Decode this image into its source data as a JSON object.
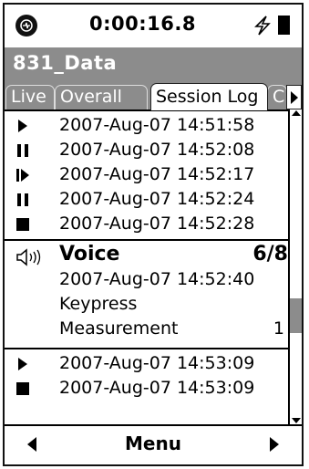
{
  "status": {
    "timer": "0:00:16.8"
  },
  "title": "831_Data",
  "tabs": [
    {
      "label": "Live",
      "active": false
    },
    {
      "label": "Overall",
      "active": false
    },
    {
      "label": "Session Log",
      "active": true
    },
    {
      "label": "C",
      "active": false
    }
  ],
  "log": {
    "top_entries": [
      {
        "icon": "play-icon",
        "timestamp": "2007-Aug-07 14:51:58"
      },
      {
        "icon": "pause-icon",
        "timestamp": "2007-Aug-07 14:52:08"
      },
      {
        "icon": "resume-icon",
        "timestamp": "2007-Aug-07 14:52:17"
      },
      {
        "icon": "pause-icon",
        "timestamp": "2007-Aug-07 14:52:24"
      },
      {
        "icon": "stop-icon",
        "timestamp": "2007-Aug-07 14:52:28"
      }
    ],
    "voice": {
      "icon": "speaker-icon",
      "label": "Voice",
      "count": "6/8",
      "timestamp": "2007-Aug-07 14:52:40",
      "line1": "Keypress",
      "line2": "Measurement",
      "number": "1"
    },
    "bottom_entries": [
      {
        "icon": "play-icon",
        "timestamp": "2007-Aug-07 14:53:09"
      },
      {
        "icon": "stop-icon",
        "timestamp": "2007-Aug-07 14:53:09"
      }
    ]
  },
  "menubar": {
    "menu_label": "Menu"
  },
  "colors": {
    "bar_gray": "#8c8c8c",
    "black": "#000000",
    "white": "#ffffff"
  }
}
